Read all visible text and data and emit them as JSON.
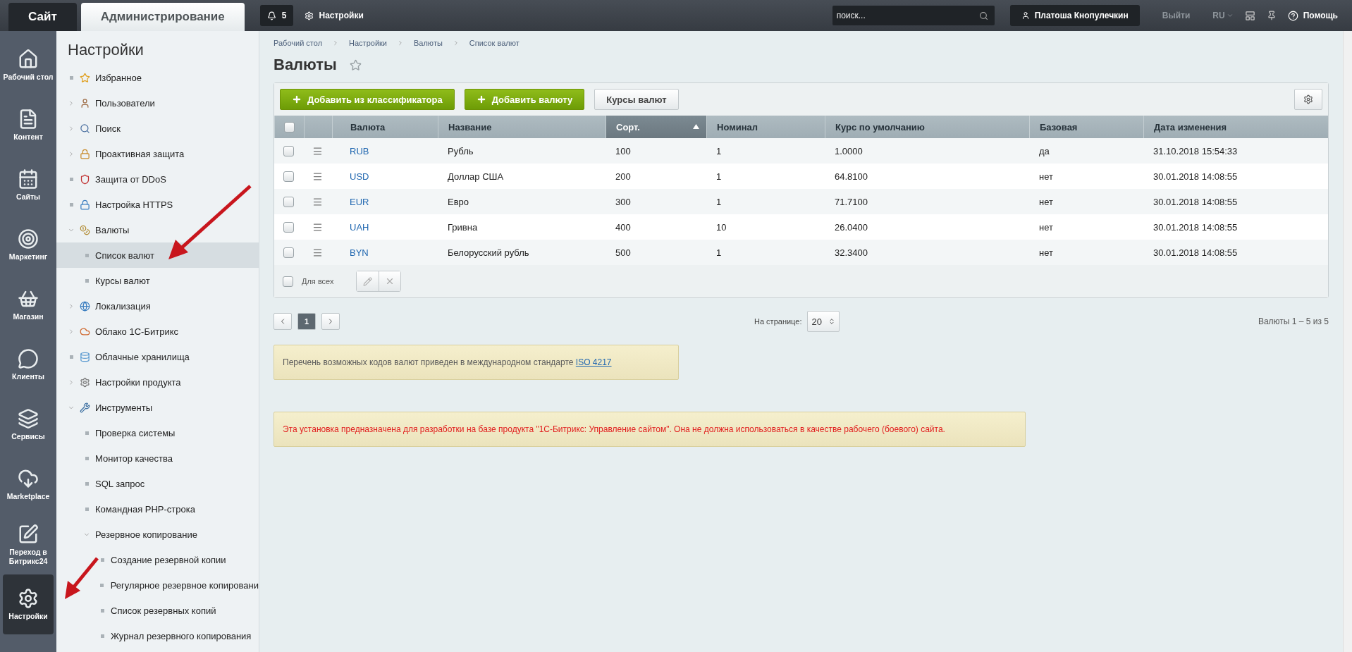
{
  "topbar": {
    "tabs": [
      {
        "label": "Сайт",
        "selected": false
      },
      {
        "label": "Администрирование",
        "selected": true
      }
    ],
    "notifications": "5",
    "settings_link": "Настройки",
    "search": {
      "placeholder": "поиск..."
    },
    "user": "Платоша Кнопулечкин",
    "logout": "Выйти",
    "language": "RU",
    "help": "Помощь"
  },
  "nav": [
    {
      "label": "Рабочий стол",
      "kind": "home",
      "selected": false
    },
    {
      "label": "Контент",
      "kind": "content",
      "selected": false
    },
    {
      "label": "Сайты",
      "kind": "sites",
      "selected": false
    },
    {
      "label": "Маркетинг",
      "kind": "marketing",
      "selected": false
    },
    {
      "label": "Магазин",
      "kind": "shop",
      "selected": false
    },
    {
      "label": "Клиенты",
      "kind": "clients",
      "selected": false
    },
    {
      "label": "Сервисы",
      "kind": "services",
      "selected": false
    },
    {
      "label": "Marketplace",
      "kind": "marketplace",
      "selected": false
    },
    {
      "label": "Переход в Битрикс24",
      "kind": "bitrix",
      "selected": false
    },
    {
      "label": "Настройки",
      "kind": "settings",
      "selected": true
    }
  ],
  "sidebar": {
    "title": "Настройки",
    "items": [
      {
        "label": "Избранное",
        "kind": "leaf",
        "selected": false
      },
      {
        "label": "Пользователи",
        "kind": "folder",
        "expanded": false,
        "selected": false
      },
      {
        "label": "Поиск",
        "kind": "folder",
        "expanded": false,
        "selected": false
      },
      {
        "label": "Проактивная защита",
        "kind": "folder",
        "expanded": false,
        "selected": false
      },
      {
        "label": "Защита от DDoS",
        "kind": "leaf",
        "selected": false
      },
      {
        "label": "Настройка HTTPS",
        "kind": "leaf",
        "selected": false
      },
      {
        "label": "Валюты",
        "kind": "folder",
        "expanded": true,
        "selected": false,
        "children": [
          {
            "label": "Список валют",
            "kind": "leaf",
            "selected": true
          },
          {
            "label": "Курсы валют",
            "kind": "leaf",
            "selected": false
          }
        ]
      },
      {
        "label": "Локализация",
        "kind": "folder",
        "expanded": false,
        "selected": false
      },
      {
        "label": "Облако 1С-Битрикс",
        "kind": "folder",
        "expanded": false,
        "selected": false
      },
      {
        "label": "Облачные хранилища",
        "kind": "leaf",
        "selected": false
      },
      {
        "label": "Настройки продукта",
        "kind": "folder",
        "expanded": false,
        "selected": false
      },
      {
        "label": "Инструменты",
        "kind": "folder",
        "expanded": true,
        "selected": false,
        "children": [
          {
            "label": "Проверка системы",
            "kind": "leaf",
            "selected": false
          },
          {
            "label": "Монитор качества",
            "kind": "leaf",
            "selected": false
          },
          {
            "label": "SQL запрос",
            "kind": "leaf",
            "selected": false
          },
          {
            "label": "Командная PHP-строка",
            "kind": "leaf",
            "selected": false
          },
          {
            "label": "Резервное копирование",
            "kind": "folder",
            "expanded": true,
            "selected": false,
            "children": [
              {
                "label": "Создание резервной копии",
                "kind": "leaf",
                "selected": false
              },
              {
                "label": "Регулярное резервное копировани",
                "kind": "leaf",
                "selected": false
              },
              {
                "label": "Список резервных копий",
                "kind": "leaf",
                "selected": false
              },
              {
                "label": "Журнал резервного копирования",
                "kind": "leaf",
                "selected": false
              }
            ]
          }
        ]
      }
    ]
  },
  "breadcrumbs": [
    "Рабочий стол",
    "Настройки",
    "Валюты",
    "Список валют"
  ],
  "page_title": "Валюты",
  "favorite": false,
  "toolbar": [
    {
      "label": "Добавить из классификатора",
      "kind": "primary"
    },
    {
      "label": "Добавить валюту",
      "kind": "primary"
    },
    {
      "label": "Курсы валют",
      "kind": "secondary"
    }
  ],
  "table": {
    "columns": [
      {
        "label": "Валюта",
        "sorted": false
      },
      {
        "label": "Название",
        "sorted": false
      },
      {
        "label": "Сорт.",
        "sorted": true
      },
      {
        "label": "Номинал",
        "sorted": false
      },
      {
        "label": "Курс по умолчанию",
        "sorted": false
      },
      {
        "label": "Базовая",
        "sorted": false
      },
      {
        "label": "Дата изменения",
        "sorted": false
      }
    ],
    "select_all": false,
    "rows": [
      {
        "checked": false,
        "cells": [
          "RUB",
          "Рубль",
          "100",
          "1",
          "1.0000",
          "да",
          "31.10.2018 15:54:33"
        ]
      },
      {
        "checked": false,
        "cells": [
          "USD",
          "Доллар США",
          "200",
          "1",
          "64.8100",
          "нет",
          "30.01.2018 14:08:55"
        ]
      },
      {
        "checked": false,
        "cells": [
          "EUR",
          "Евро",
          "300",
          "1",
          "71.7100",
          "нет",
          "30.01.2018 14:08:55"
        ]
      },
      {
        "checked": false,
        "cells": [
          "UAH",
          "Гривна",
          "400",
          "10",
          "26.0400",
          "нет",
          "30.01.2018 14:08:55"
        ]
      },
      {
        "checked": false,
        "cells": [
          "BYN",
          "Белорусский рубль",
          "500",
          "1",
          "32.3400",
          "нет",
          "30.01.2018 14:08:55"
        ]
      }
    ],
    "for_all": {
      "label": "Для всех",
      "checked": false
    }
  },
  "pager": {
    "pages": [
      {
        "label": "1",
        "selected": true
      }
    ],
    "per_page_label": "На странице:",
    "per_page": "20",
    "summary": "Валюты 1 – 5 из 5"
  },
  "info_note": {
    "text": "Перечень возможных кодов валют приведен в международном стандарте",
    "link": "ISO 4217"
  },
  "warning": "Эта установка предназначена для разработки на базе продукта \"1С-Битрикс: Управление сайтом\". Она не должна использоваться в качестве рабочего (боевого) сайта."
}
